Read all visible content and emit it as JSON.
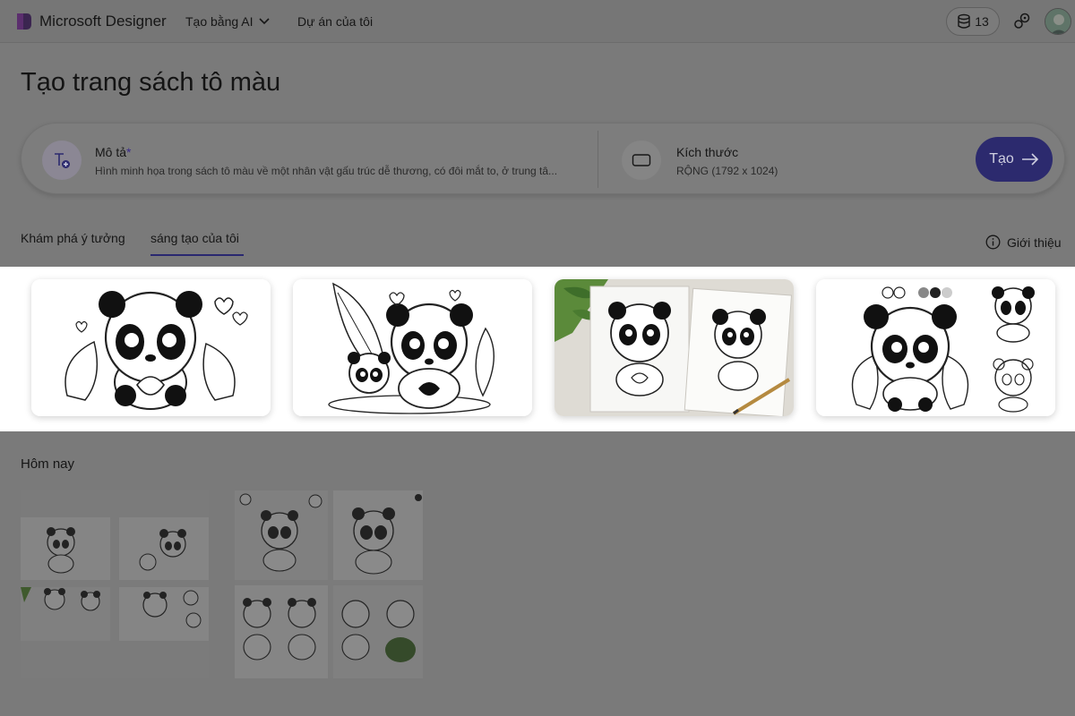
{
  "header": {
    "app_title": "Microsoft Designer",
    "nav": {
      "create_with_ai": "Tạo bằng AI",
      "my_projects": "Dự án của tôi"
    },
    "credits_count": "13"
  },
  "page": {
    "title": "Tạo trang sách tô màu"
  },
  "prompt": {
    "description_label": "Mô tả",
    "required_mark": "*",
    "description_text": "Hình minh họa trong sách tô màu về một nhân vật gấu trúc dễ thương, có đôi mắt to, ở trung tâ...",
    "size_label": "Kích thước",
    "size_value": "RỘNG (1792 x 1024)",
    "create_button": "Tạo"
  },
  "tabs": {
    "explore": "Khám phá ý tưởng",
    "mine": "sáng tạo của tôi",
    "active": "mine"
  },
  "about_label": "Giới thiệu",
  "history": {
    "section_title": "Hôm nay"
  },
  "colors": {
    "accent": "#2c2a6e",
    "overlay": "#7a7a7a",
    "card_background": "#ffffff"
  },
  "icons": {
    "logo": "designer-logo",
    "chevron": "chevron-down-icon",
    "credits": "coin-stack-icon",
    "tools": "tools-icon",
    "description": "text-add-icon",
    "size": "rectangle-icon",
    "arrow": "arrow-right-icon",
    "info": "info-icon"
  }
}
